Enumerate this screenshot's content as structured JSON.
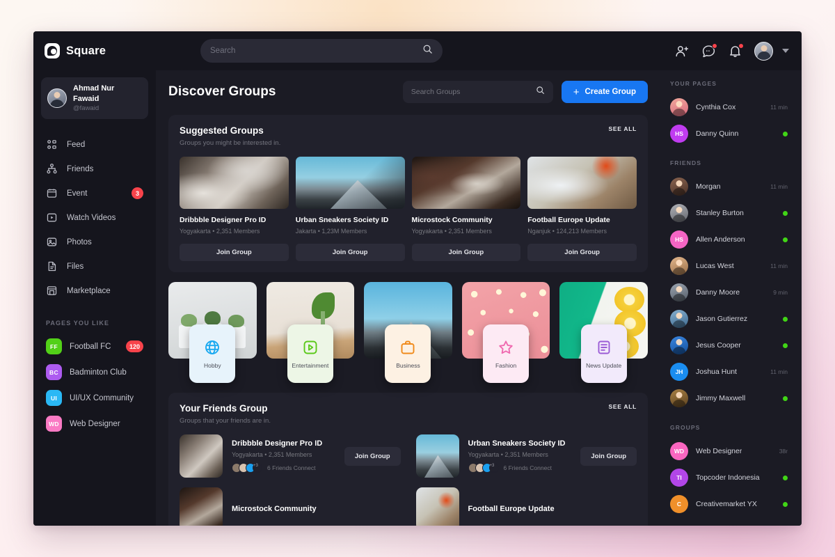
{
  "brand": {
    "name": "Square"
  },
  "topbar": {
    "search_placeholder": "Search",
    "icons": [
      "add-friend-icon",
      "messages-icon",
      "notifications-icon"
    ]
  },
  "profile": {
    "name": "Ahmad Nur Fawaid",
    "handle": "@fawaid"
  },
  "sidebar": {
    "nav": [
      {
        "label": "Feed",
        "icon": "grid-icon",
        "badge": ""
      },
      {
        "label": "Friends",
        "icon": "network-icon",
        "badge": ""
      },
      {
        "label": "Event",
        "icon": "calendar-icon",
        "badge": "3"
      },
      {
        "label": "Watch Videos",
        "icon": "video-icon",
        "badge": ""
      },
      {
        "label": "Photos",
        "icon": "photo-icon",
        "badge": ""
      },
      {
        "label": "Files",
        "icon": "file-icon",
        "badge": ""
      },
      {
        "label": "Marketplace",
        "icon": "store-icon",
        "badge": ""
      }
    ],
    "pages_heading": "PAGES YOU LIKE",
    "pages": [
      {
        "label": "Football FC",
        "initials": "FF",
        "color": "#52d018",
        "badge": "120"
      },
      {
        "label": "Badminton Club",
        "initials": "BC",
        "color": "#ad5bf0",
        "badge": ""
      },
      {
        "label": "UI/UX Community",
        "initials": "UI",
        "color": "#2ab8f5",
        "badge": ""
      },
      {
        "label": "Web Designer",
        "initials": "WD",
        "color": "#fa7ac4",
        "badge": ""
      }
    ]
  },
  "main": {
    "title": "Discover Groups",
    "search_placeholder": "Search Groups",
    "create_label": "Create Group",
    "suggested": {
      "title": "Suggested Groups",
      "subtitle": "Groups you might be interested in.",
      "see_all": "SEE ALL",
      "join_label": "Join Group",
      "cards": [
        {
          "name": "Dribbble Designer Pro ID",
          "meta": "Yogyakarta • 2,351 Members",
          "thumb": "desk-laptop-photo"
        },
        {
          "name": "Urban Sneakers Society ID",
          "meta": "Jakarta • 1,23M Members",
          "thumb": "mountain-photo"
        },
        {
          "name": "Microstock Community",
          "meta": "Yogyakarta • 2,351 Members",
          "thumb": "motorcycle-garage-photo"
        },
        {
          "name": "Football Europe Update",
          "meta": "Nganjuk • 124,213 Members",
          "thumb": "blueprint-tools-photo"
        }
      ]
    },
    "categories": [
      {
        "label": "Hobby",
        "icon": "globe-icon",
        "color": "#1aa9f0",
        "chip_bg": "#e7f3fb",
        "img": "plants-photo"
      },
      {
        "label": "Entertainment",
        "icon": "play-icon",
        "color": "#5bc91a",
        "chip_bg": "#edf6e6",
        "img": "leaf-glass-photo"
      },
      {
        "label": "Business",
        "icon": "briefcase-icon",
        "color": "#f08a1a",
        "chip_bg": "#fdf1e3",
        "img": "mountain-sky-photo"
      },
      {
        "label": "Fashion",
        "icon": "star-icon",
        "color": "#f06ab0",
        "chip_bg": "#fdeaf4",
        "img": "pink-flowers-photo"
      },
      {
        "label": "News Update",
        "icon": "document-icon",
        "color": "#9b5bd6",
        "chip_bg": "#f2eafb",
        "img": "lemon-photo"
      }
    ],
    "friends_group": {
      "title": "Your Friends Group",
      "subtitle": "Groups that your friends are in.",
      "see_all": "SEE ALL",
      "join_label": "Join Group",
      "connect_label": "6 Friends Connect",
      "more_label": "+3",
      "rows": [
        {
          "name": "Dribbble Designer Pro ID",
          "meta": "Yogyakarta • 2,351 Members",
          "thumb": "desk-laptop-photo"
        },
        {
          "name": "Urban Sneakers Society ID",
          "meta": "Yogyakarta • 2,351 Members",
          "thumb": "mountain-photo"
        },
        {
          "name": "Microstock Community",
          "meta": "",
          "thumb": "motorcycle-garage-photo"
        },
        {
          "name": "Football Europe Update",
          "meta": "",
          "thumb": "blueprint-tools-photo"
        }
      ]
    }
  },
  "right": {
    "pages_heading": "YOUR PAGES",
    "pages": [
      {
        "name": "Cynthia Cox",
        "time": "11 min",
        "online": false,
        "initials": "",
        "color": "#e98e9a"
      },
      {
        "name": "Danny Quinn",
        "time": "",
        "online": true,
        "initials": "HS",
        "color": "#c03cf0"
      }
    ],
    "friends_heading": "FRIENDS",
    "friends": [
      {
        "name": "Morgan",
        "time": "11 min",
        "online": false,
        "initials": "",
        "color": "#7c5a48"
      },
      {
        "name": "Stanley Burton",
        "time": "",
        "online": true,
        "initials": "",
        "color": "#8b8b92"
      },
      {
        "name": "Allen Anderson",
        "time": "",
        "online": true,
        "initials": "HS",
        "color": "#f465c4"
      },
      {
        "name": "Lucas West",
        "time": "11 min",
        "online": false,
        "initials": "",
        "color": "#c79a72"
      },
      {
        "name": "Danny Moore",
        "time": "9 min",
        "online": false,
        "initials": "",
        "color": "#6f7783"
      },
      {
        "name": "Jason Gutierrez",
        "time": "",
        "online": true,
        "initials": "",
        "color": "#5c8fb8"
      },
      {
        "name": "Jesus Cooper",
        "time": "",
        "online": true,
        "initials": "",
        "color": "#1a64c8"
      },
      {
        "name": "Joshua Hunt",
        "time": "11 min",
        "online": false,
        "initials": "JH",
        "color": "#1a8df0"
      },
      {
        "name": "Jimmy Maxwell",
        "time": "",
        "online": true,
        "initials": "",
        "color": "#8a6b3a"
      }
    ],
    "groups_heading": "GROUPS",
    "groups": [
      {
        "name": "Web Designer",
        "time": "38r",
        "online": false,
        "initials": "WD",
        "color": "#fa66c0"
      },
      {
        "name": "Topcoder Indonesia",
        "time": "",
        "online": true,
        "initials": "TI",
        "color": "#b246e8"
      },
      {
        "name": "Creativemarket YX",
        "time": "",
        "online": true,
        "initials": "C",
        "color": "#f0902a"
      }
    ]
  }
}
